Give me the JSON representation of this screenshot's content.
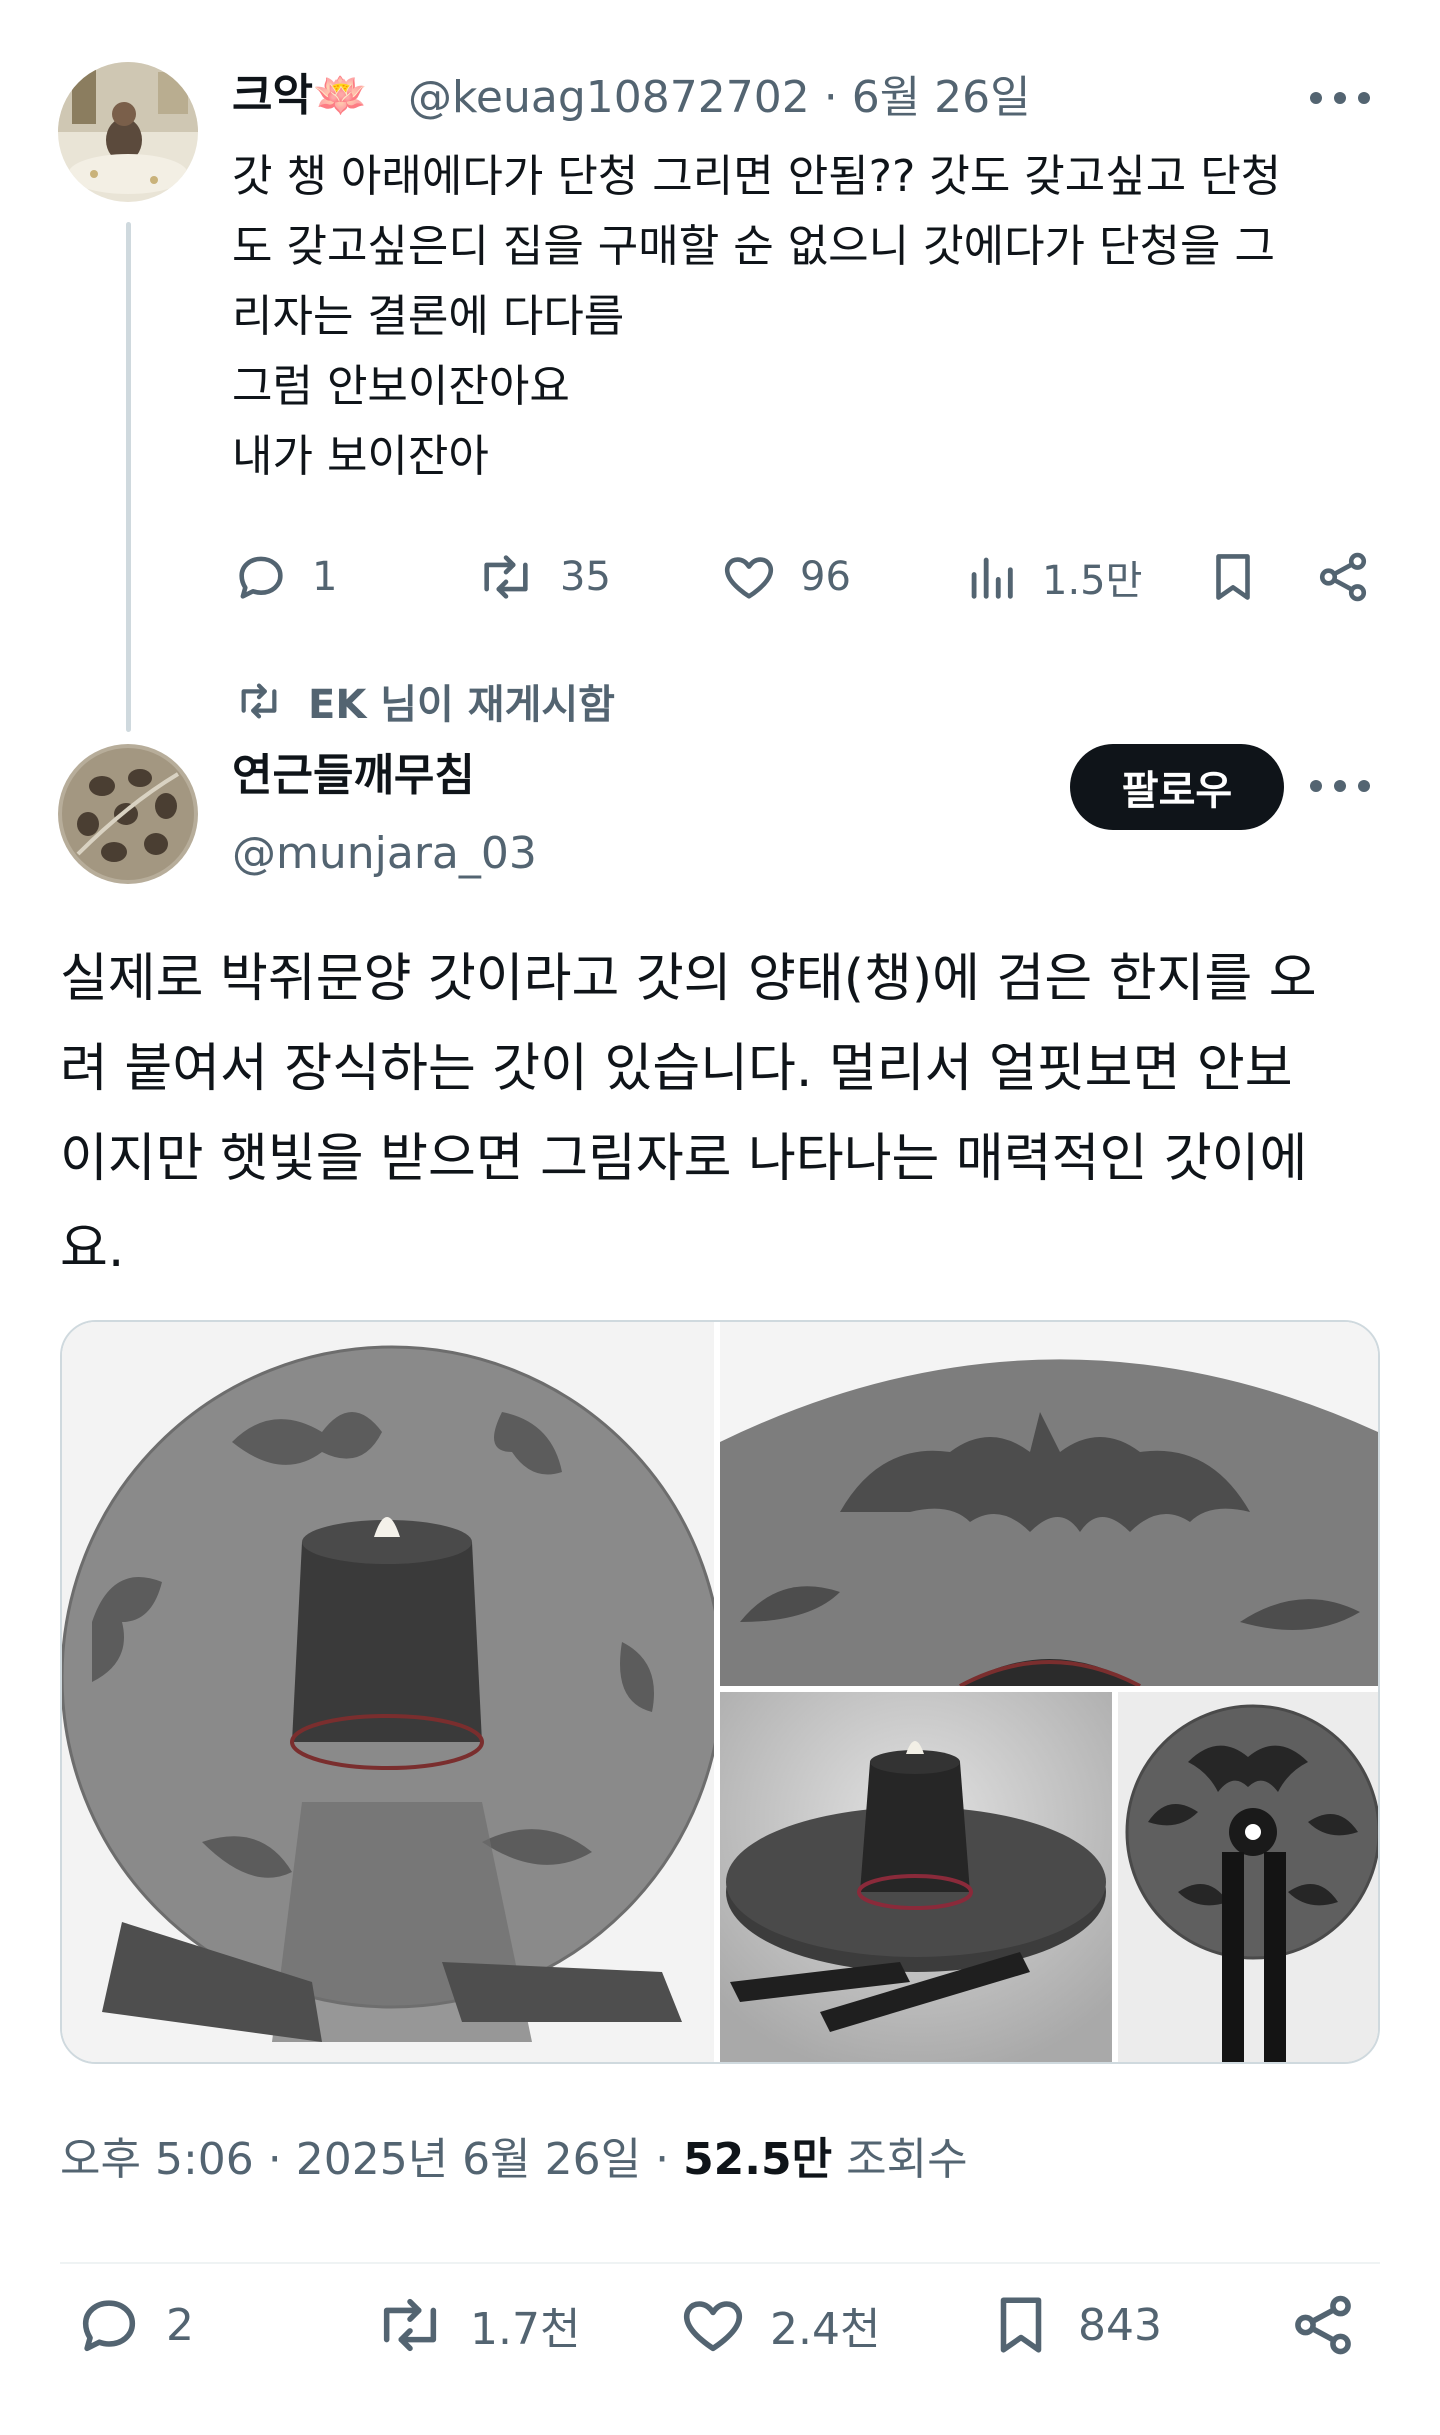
{
  "parent_tweet": {
    "display_name": "크악🪷",
    "handle": "@keuag10872702",
    "date": "6월 26일",
    "text_lines": [
      "갓 챙 아래에다가 단청 그리면 안됨?? 갓도 갖고싶고 단청",
      "도 갖고싶은디 집을 구매할 순 없으니 갓에다가 단청을 그",
      "리자는 결론에 다다름",
      "그럼 안보이잔아요",
      "내가 보이잔아"
    ],
    "actions": {
      "replies": "1",
      "reposts": "35",
      "likes": "96",
      "views": "1.5만"
    }
  },
  "repost_label": "EK 님이 재게시함",
  "main_tweet": {
    "display_name": "연근들깨무침",
    "handle": "@munjara_03",
    "follow_label": "팔로우",
    "text_lines": [
      "실제로 박쥐문양 갓이라고 갓의 양태(챙)에 검은 한지를 오",
      "려 붙여서 장식하는 갓이 있습니다. 멀리서 얼핏보면 안보",
      "이지만 햇빛을 받으면 그림자로 나타나는 매력적인 갓이에",
      "요."
    ],
    "time": "오후 5:06 · 2025년 6월 26일 ·",
    "views_count": "52.5만",
    "views_label": "조회수",
    "actions": {
      "replies": "2",
      "reposts": "1.7천",
      "likes": "2.4천",
      "bookmarks": "843"
    }
  },
  "colors": {
    "text": "#0f1419",
    "muted": "#536471",
    "divider": "#eff3f4",
    "thread_line": "#cfd9de",
    "follow_bg": "#0f1419"
  },
  "icons": [
    "reply-icon",
    "repost-icon",
    "like-icon",
    "views-icon",
    "bookmark-icon",
    "share-icon",
    "more-icon"
  ]
}
